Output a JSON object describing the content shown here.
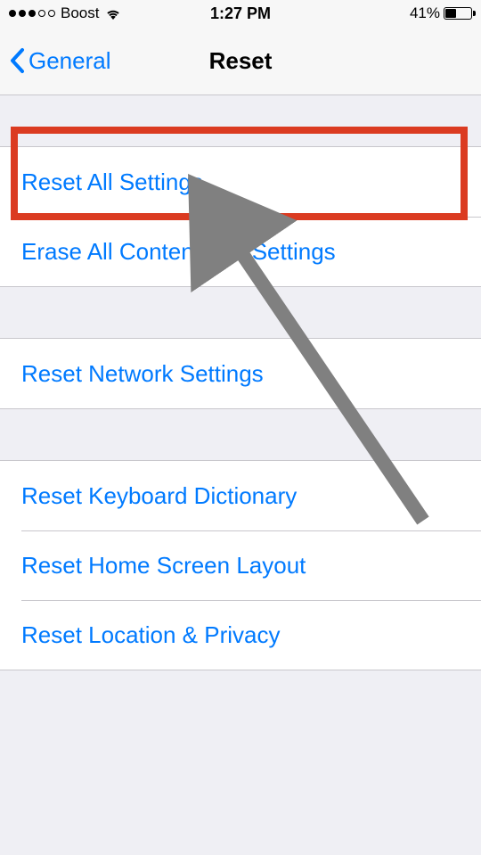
{
  "statusBar": {
    "carrier": "Boost",
    "time": "1:27 PM",
    "batteryPct": "41%"
  },
  "nav": {
    "back": "General",
    "title": "Reset"
  },
  "groups": [
    {
      "items": [
        {
          "label": "Reset All Settings"
        },
        {
          "label": "Erase All Content and Settings"
        }
      ]
    },
    {
      "items": [
        {
          "label": "Reset Network Settings"
        }
      ]
    },
    {
      "items": [
        {
          "label": "Reset Keyboard Dictionary"
        },
        {
          "label": "Reset Home Screen Layout"
        },
        {
          "label": "Reset Location & Privacy"
        }
      ]
    }
  ],
  "annotation": {
    "highlightColor": "#db3b21",
    "arrowColor": "#808080"
  }
}
